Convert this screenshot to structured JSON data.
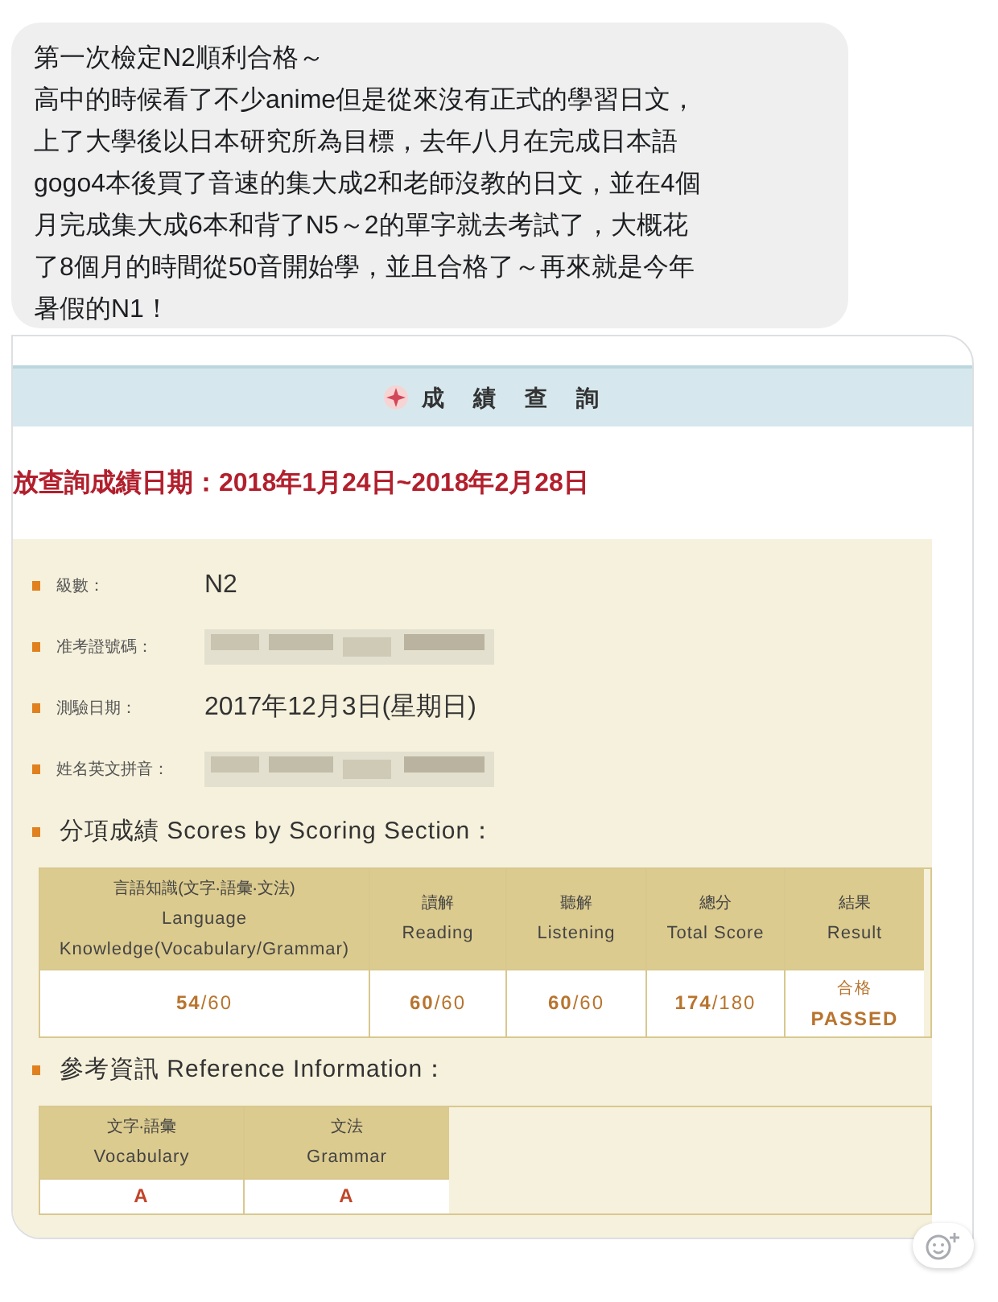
{
  "message": {
    "lines": [
      "第一次檢定N2順利合格～",
      "高中的時候看了不少anime但是從來沒有正式的學習日文，",
      "上了大學後以日本研究所為目標，去年八月在完成日本語",
      "gogo4本後買了音速的集大成2和老師沒教的日文，並在4個",
      "月完成集大成6本和背了N5～2的單字就去考試了，大概花",
      "了8個月的時間從50音開始學，並且合格了～再來就是今年",
      "暑假的N1！"
    ]
  },
  "score_page": {
    "title": "成　績　查　詢",
    "date_range": "放查詢成績日期：2018年1月24日~2018年2月28日",
    "fields": [
      {
        "label": "級數：",
        "kind": "text",
        "value": "N2"
      },
      {
        "label": "准考證號碼：",
        "kind": "redacted"
      },
      {
        "label": "測驗日期：",
        "kind": "text",
        "value": "2017年12月3日(星期日)"
      },
      {
        "label": "姓名英文拼音：",
        "kind": "redacted"
      }
    ],
    "sections": [
      {
        "heading": "分項成績 Scores by Scoring Section：",
        "columns": [
          [
            "言語知識(文字‧語彙‧文法)",
            "Language",
            "Knowledge(Vocabulary/Grammar)"
          ],
          [
            "讀解",
            "Reading"
          ],
          [
            "聽解",
            "Listening"
          ],
          [
            "總分",
            "Total Score"
          ],
          [
            "結果",
            "Result"
          ]
        ],
        "cells": [
          [
            "**54**/60"
          ],
          [
            "**60**/60"
          ],
          [
            "**60**/60"
          ],
          [
            "**174**/180"
          ],
          [
            "合格",
            "PASSED"
          ]
        ]
      },
      {
        "heading": "參考資訊 Reference Information：",
        "columns": [
          [
            "文字‧語彙",
            "Vocabulary"
          ],
          [
            "文法",
            "Grammar"
          ]
        ],
        "cells": [
          [
            "A"
          ],
          [
            "A"
          ]
        ]
      }
    ]
  }
}
